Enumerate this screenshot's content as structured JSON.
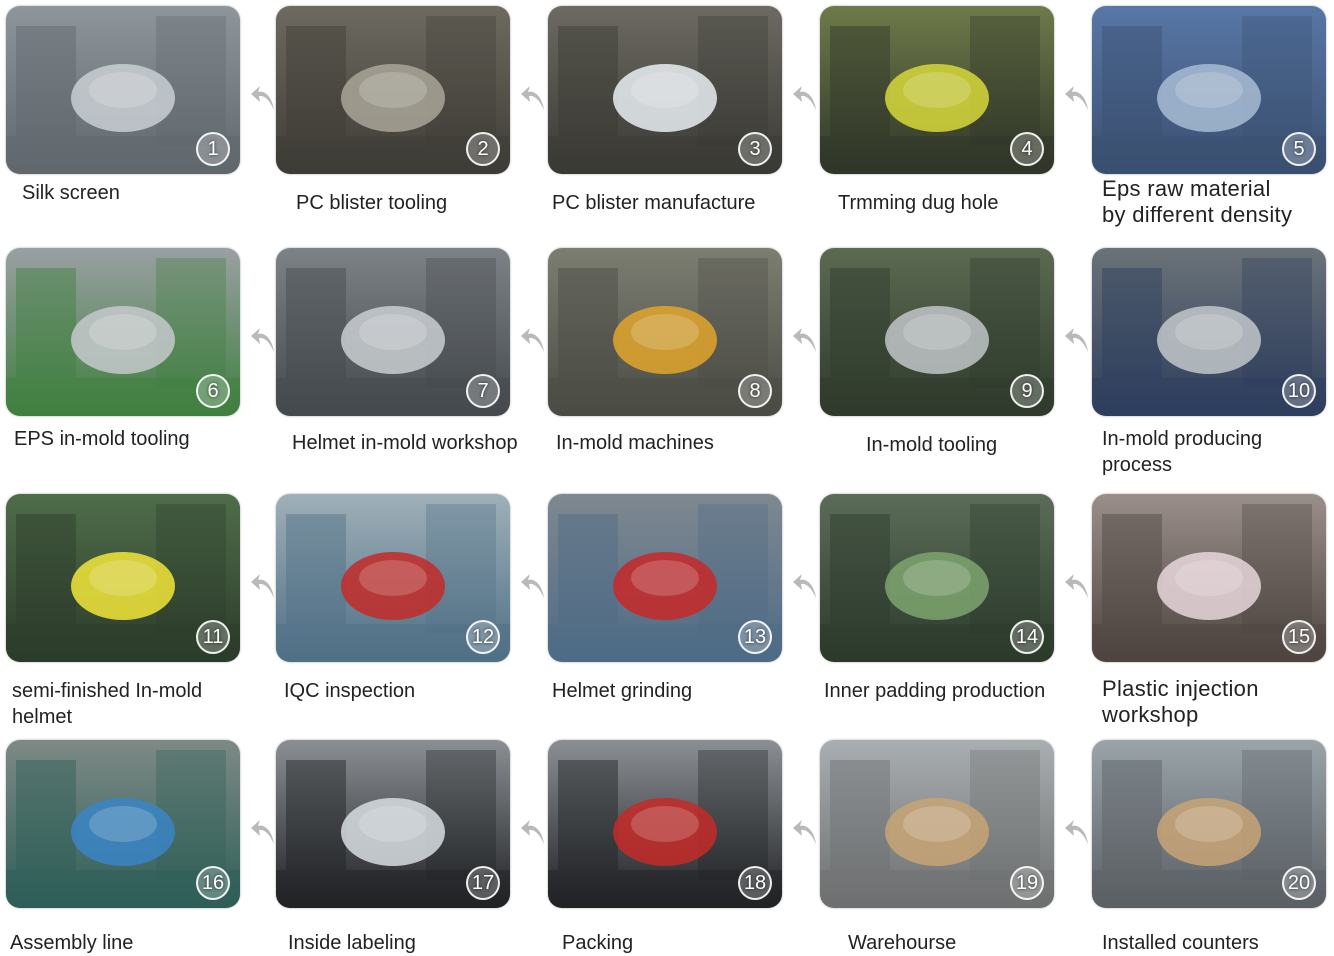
{
  "steps": [
    {
      "n": "1",
      "label": "Silk screen"
    },
    {
      "n": "2",
      "label": "PC blister tooling"
    },
    {
      "n": "3",
      "label": "PC blister manufacture"
    },
    {
      "n": "4",
      "label": "Trmming dug hole"
    },
    {
      "n": "5",
      "label": "Eps raw material",
      "label2": "by different density"
    },
    {
      "n": "6",
      "label": "EPS in-mold tooling"
    },
    {
      "n": "7",
      "label": "Helmet in-mold workshop"
    },
    {
      "n": "8",
      "label": "In-mold machines"
    },
    {
      "n": "9",
      "label": "In-mold tooling"
    },
    {
      "n": "10",
      "label": "In-mold producing",
      "label2": "process"
    },
    {
      "n": "11",
      "label": "semi-finished In-mold",
      "label2": "helmet"
    },
    {
      "n": "12",
      "label": "IQC inspection"
    },
    {
      "n": "13",
      "label": "Helmet grinding"
    },
    {
      "n": "14",
      "label": "Inner padding production"
    },
    {
      "n": "15",
      "label": "Plastic injection",
      "label2": "workshop"
    },
    {
      "n": "16",
      "label": "Assembly line"
    },
    {
      "n": "17",
      "label": "Inside labeling"
    },
    {
      "n": "18",
      "label": "Packing"
    },
    {
      "n": "19",
      "label": "Warehourse"
    },
    {
      "n": "20",
      "label": "Installed counters"
    }
  ],
  "colors": {
    "arrow": "#b9b9b9",
    "label_text": "#222222"
  }
}
